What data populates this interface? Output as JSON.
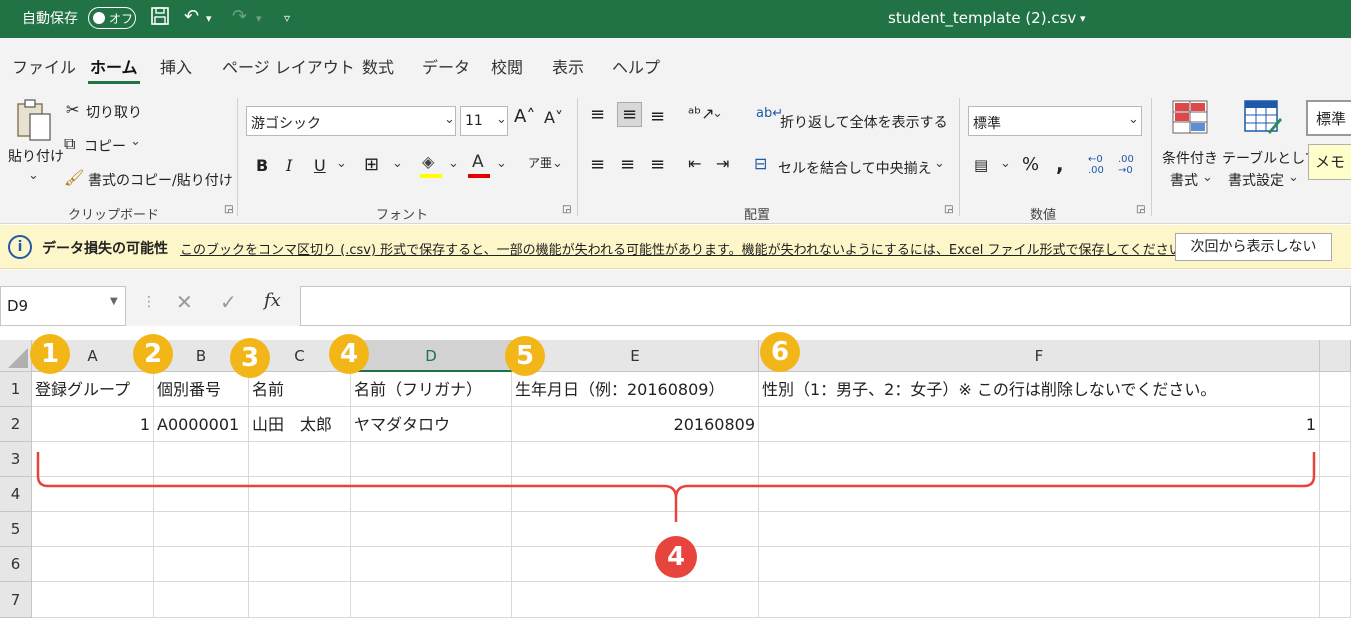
{
  "titlebar": {
    "autosave_label": "自動保存",
    "autosave_state": "オフ",
    "doc_title": "student_template (2).csv",
    "save_icon": "save-icon",
    "undo_icon": "undo-icon",
    "redo_icon": "redo-icon"
  },
  "tabs": [
    "ファイル",
    "ホーム",
    "挿入",
    "ページ レイアウト",
    "数式",
    "データ",
    "校閲",
    "表示",
    "ヘルプ"
  ],
  "ribbon": {
    "paste": "貼り付け",
    "cut": "切り取り",
    "copy": "コピー",
    "format_painter": "書式のコピー/貼り付け",
    "clipboard_group": "クリップボード",
    "font_name": "游ゴシック",
    "font_size": "11",
    "font_group": "フォント",
    "wrap_text": "折り返して全体を表示する",
    "merge_center": "セルを結合して中央揃え",
    "alignment_group": "配置",
    "number_format": "標準",
    "number_group": "数値",
    "conditional_format": "条件付き",
    "conditional_format2": "書式",
    "table_format": "テーブルとして",
    "table_format2": "書式設定",
    "style_standard": "標準",
    "style_memo": "メモ"
  },
  "infobar": {
    "title": "データ損失の可能性",
    "message": "このブックをコンマ区切り (.csv) 形式で保存すると、一部の機能が失われる可能性があります。機能が失われないようにするには、Excel ファイル形式で保存してください。",
    "dismiss_button": "次回から表示しない"
  },
  "formula_bar": {
    "name_box": "D9",
    "formula": ""
  },
  "columns": [
    "A",
    "B",
    "C",
    "D",
    "E",
    "F"
  ],
  "rows": [
    "1",
    "2",
    "3",
    "4",
    "5",
    "6",
    "7"
  ],
  "cells": {
    "A1": "登録グループ",
    "B1": "個別番号",
    "C1": "名前",
    "D1": "名前（フリガナ）",
    "E1": "生年月日（例：20160809）",
    "F1": "性別（1：男子、2：女子）※ この行は削除しないでください。",
    "A2": "1",
    "B2": "A0000001",
    "C2": "山田　太郎",
    "D2": "ヤマダタロウ",
    "E2": "20160809",
    "F2": "1"
  },
  "badges": [
    "1",
    "2",
    "3",
    "4",
    "5",
    "6"
  ],
  "bracket_badge": "4",
  "colors": {
    "excel_green": "#217346",
    "badge_yellow": "#f2b619",
    "badge_red": "#e8443e"
  }
}
